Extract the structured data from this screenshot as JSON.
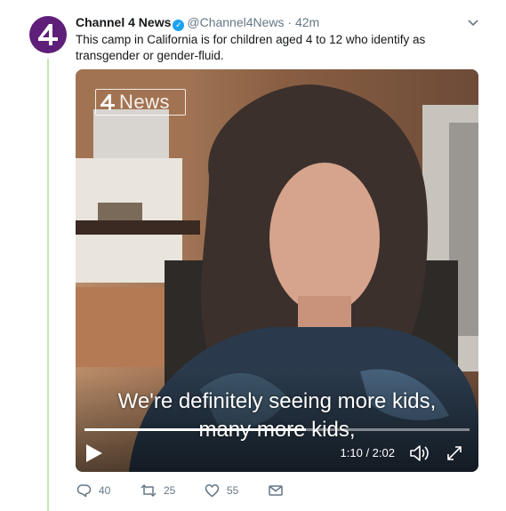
{
  "tweet": {
    "display_name": "Channel 4 News",
    "handle": "@Channel4News",
    "separator": "·",
    "time": "42m",
    "verified": true,
    "text": "This camp in California is for children aged 4 to 12 who identify as transgender or gender-fluid.",
    "avatar_color": "#5e1f78",
    "avatar_icon": "channel-4-logo-icon"
  },
  "video": {
    "watermark_text": "News",
    "subtitle_line1": "We're definitely seeing more kids,",
    "subtitle_line2": "many more kids,",
    "time_display": "1:10 / 2:02",
    "progress_fraction": 0.574
  },
  "actions": {
    "replies": "40",
    "retweets": "25",
    "likes": "55"
  },
  "colors": {
    "thread_line": "#c5e7b3",
    "verified_badge": "#1da1f2",
    "meta_gray": "#657786"
  }
}
